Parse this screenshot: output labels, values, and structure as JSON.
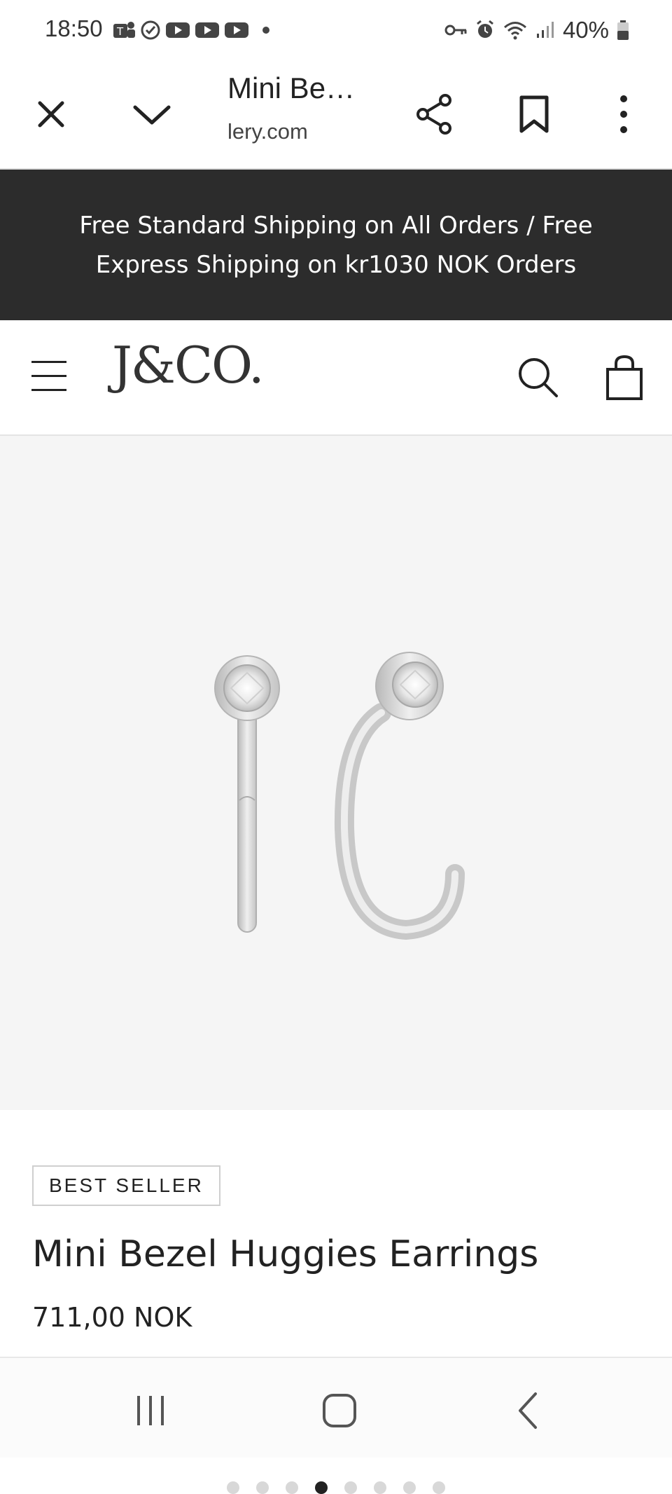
{
  "status": {
    "time": "18:50",
    "battery": "40%"
  },
  "browser": {
    "page_title": "Mini Be…",
    "domain": "lery.com"
  },
  "banner": {
    "text": "Free Standard Shipping on All Orders / Free Express Shipping on kr1030 NOK Orders"
  },
  "site": {
    "logo": "J&CO."
  },
  "gallery": {
    "total_images": 8,
    "active_index": 3
  },
  "product": {
    "badge": "BEST SELLER",
    "title": "Mini Bezel Huggies Earrings",
    "price": "711,00 NOK"
  },
  "colors": {
    "banner_bg": "#2c2c2c",
    "gallery_bg": "#f5f5f5",
    "text": "#222222"
  }
}
